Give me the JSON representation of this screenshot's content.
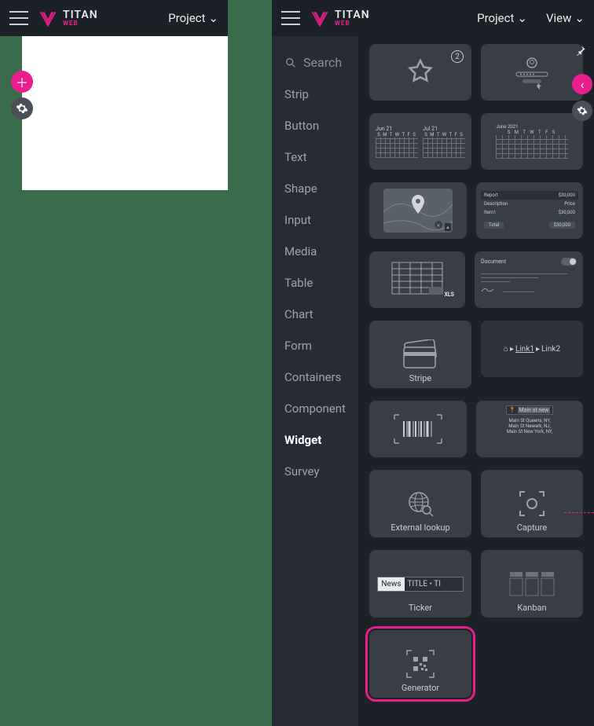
{
  "app": {
    "name": "TITAN",
    "sub": "WEB"
  },
  "menu": {
    "project": "Project",
    "view": "View"
  },
  "sidebar": {
    "search_placeholder": "Search",
    "items": [
      "Strip",
      "Button",
      "Text",
      "Shape",
      "Input",
      "Media",
      "Table",
      "Chart",
      "Form",
      "Containers",
      "Component",
      "Widget",
      "Survey"
    ],
    "active": "Widget"
  },
  "widgets": {
    "favorite_badge": "2",
    "cal_left": "Jun 21",
    "cal_right": "Jul 21",
    "cal_days": "S M T W T F S",
    "cal_month": "June     2021",
    "report": {
      "title": "Report",
      "amount": "$30,000",
      "desc": "Description",
      "price": "Price",
      "item": "Item1",
      "item_amount": "$30,000",
      "total": "Total",
      "total_amount": "$30,000"
    },
    "xls": "XLS",
    "doc_title": "Document",
    "stripe": "Stripe",
    "breadcrumb": {
      "home": "⌂",
      "link1": "Link1",
      "link2": "Link2"
    },
    "address": {
      "search": "Main st new",
      "lines": [
        "Main St Queens, NY,",
        "Main St Newark, NJ,",
        "Main St New York, NY,"
      ]
    },
    "external": "External lookup",
    "capture": "Capture",
    "ticker": {
      "news": "News",
      "title": "TITLE • TI",
      "label": "Ticker"
    },
    "kanban": "Kanban",
    "generator": "Generator"
  }
}
